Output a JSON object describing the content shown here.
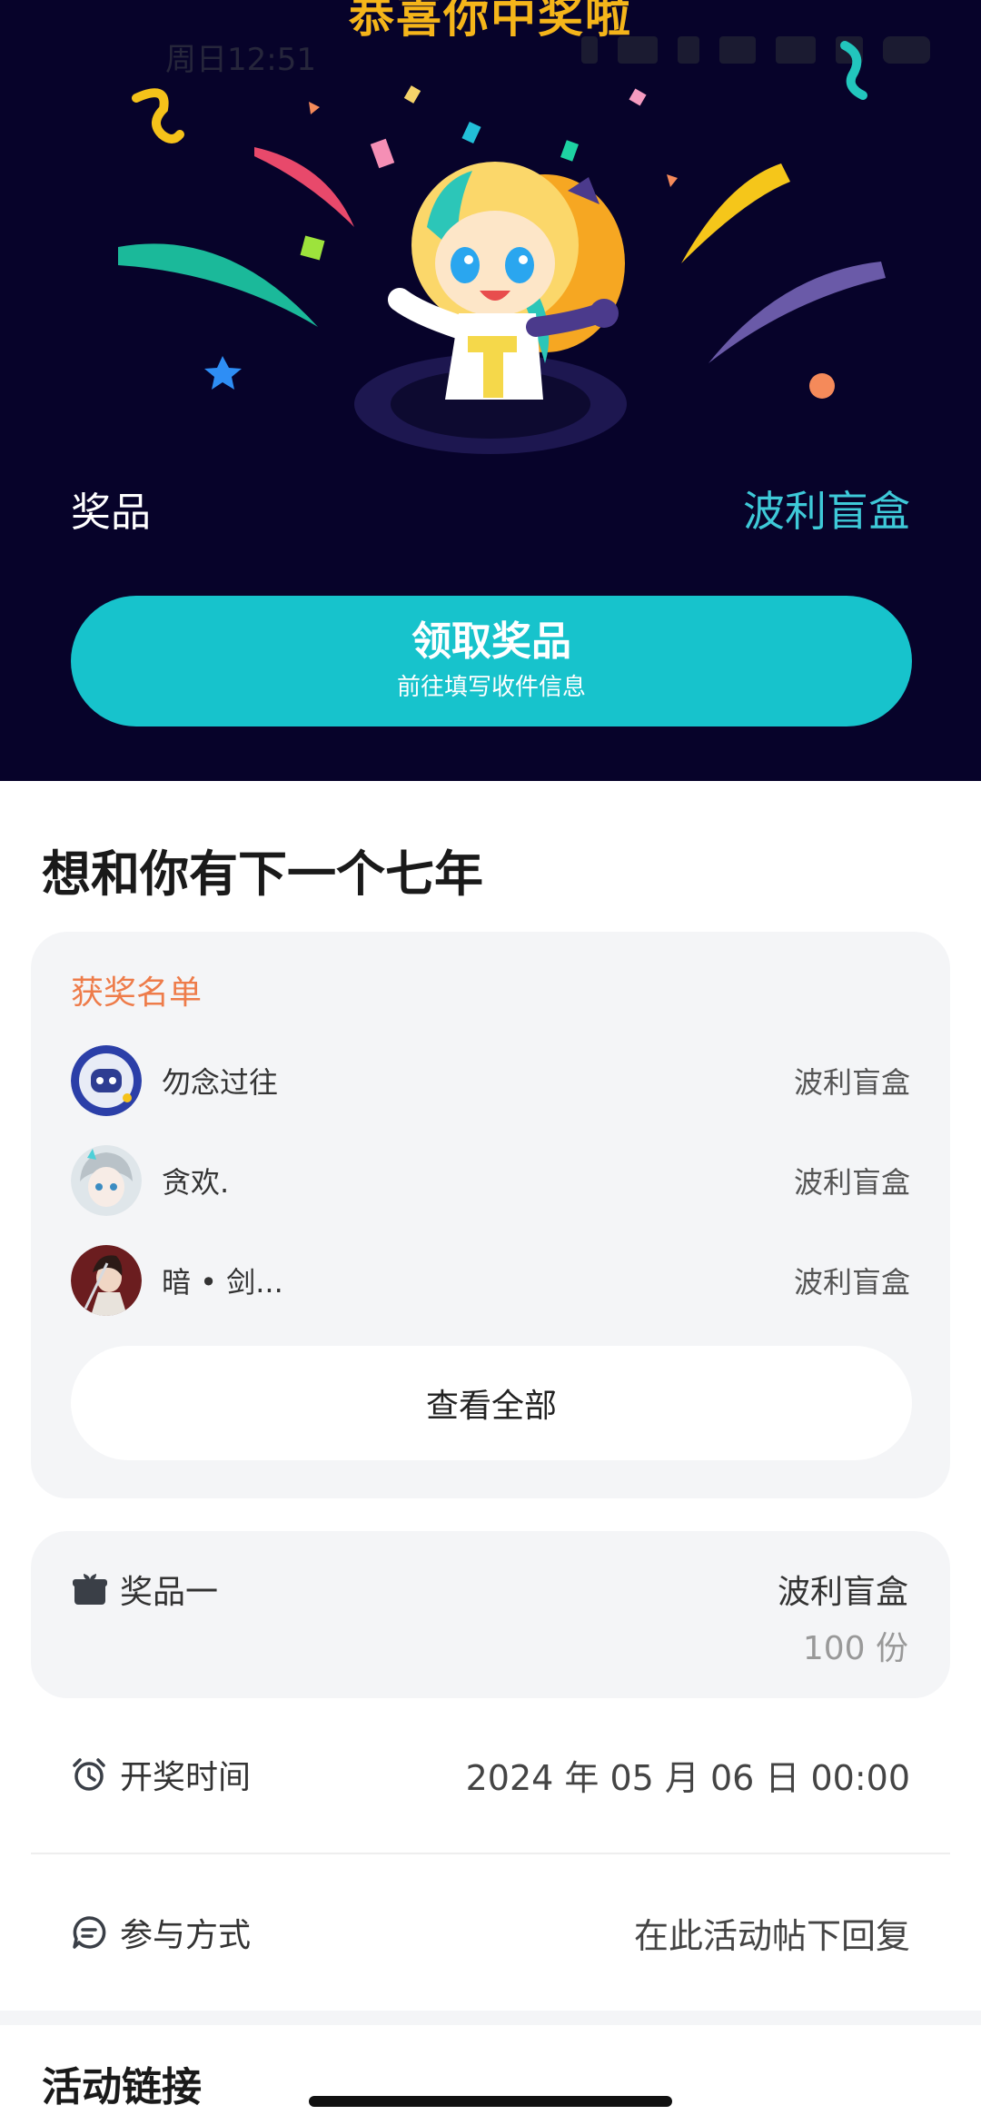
{
  "hero": {
    "headline": "恭喜你中奖啦",
    "status_time": "周日12:51",
    "prize_label": "奖品",
    "prize_value": "波利盲盒",
    "claim_button": {
      "title": "领取奖品",
      "subtitle": "前往填写收件信息"
    },
    "colors": {
      "background": "#07032a",
      "accent": "#17c3cc",
      "headline": "#f5b51a"
    }
  },
  "activity": {
    "title": "想和你有下一个七年"
  },
  "winners": {
    "header": "获奖名单",
    "items": [
      {
        "name": "勿念过往",
        "prize": "波利盲盒",
        "avatar": "robot-avatar"
      },
      {
        "name": "贪欢.",
        "prize": "波利盲盒",
        "avatar": "anime-girl-avatar"
      },
      {
        "name": "暗 • 剑...",
        "prize": "波利盲盒",
        "avatar": "swordsman-avatar"
      }
    ],
    "view_all": "查看全部"
  },
  "prize_info": {
    "label": "奖品一",
    "name": "波利盲盒",
    "count": "100 份"
  },
  "draw_time": {
    "label": "开奖时间",
    "value": "2024 年 05 月 06 日 00:00"
  },
  "participation": {
    "label": "参与方式",
    "value": "在此活动帖下回复"
  },
  "next_section": {
    "title": "活动链接"
  }
}
